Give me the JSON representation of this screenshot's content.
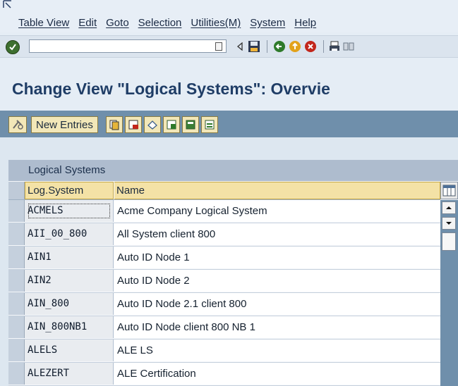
{
  "menu": {
    "items": [
      "Table View",
      "Edit",
      "Goto",
      "Selection",
      "Utilities(M)",
      "System",
      "Help"
    ]
  },
  "command_field": {
    "value": ""
  },
  "title": "Change View \"Logical Systems\": Overvie",
  "app_toolbar": {
    "new_entries_label": "New Entries"
  },
  "table": {
    "title": "Logical Systems",
    "columns": [
      "Log.System",
      "Name"
    ],
    "rows": [
      {
        "system": "ACMELS",
        "name": "Acme Company Logical System"
      },
      {
        "system": "AII_00_800",
        "name": "All System client 800"
      },
      {
        "system": "AIN1",
        "name": "Auto ID Node 1"
      },
      {
        "system": "AIN2",
        "name": "Auto ID Node 2"
      },
      {
        "system": "AIN_800",
        "name": "Auto ID Node 2.1 client 800"
      },
      {
        "system": "AIN_800NB1",
        "name": "Auto ID Node client 800 NB 1"
      },
      {
        "system": "ALELS",
        "name": "ALE LS"
      },
      {
        "system": "ALEZERT",
        "name": "ALE Certification"
      }
    ]
  },
  "colors": {
    "title_text": "#1f3d66",
    "app_toolbar_bg": "#6f8fab",
    "header_bg": "#f4e2a6",
    "button_bg": "#f2e7b8"
  },
  "icons": {
    "standard_toolbar": [
      "enter-icon",
      "command-history-icon",
      "back-arrow-icon",
      "save-icon",
      "back-icon",
      "exit-icon",
      "cancel-icon",
      "print-icon",
      "find-icon"
    ],
    "application_toolbar": [
      "display-change-icon",
      "copy-as-icon",
      "delete-icon",
      "undo-change-icon",
      "select-all-icon",
      "select-block-icon",
      "deselect-all-icon"
    ]
  }
}
